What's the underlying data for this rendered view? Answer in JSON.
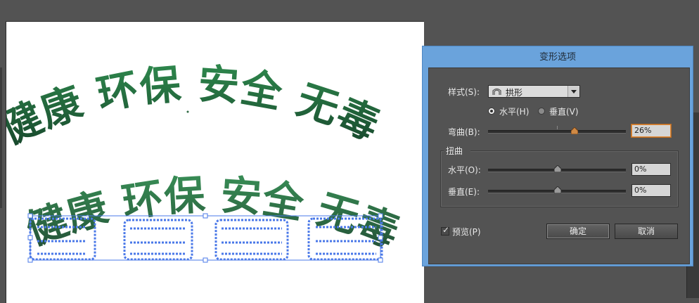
{
  "colors": {
    "workspace": "#535353",
    "dialog_title_bar": "#6aa3dc",
    "dialog_body": "#535353",
    "text_green_dark": "#1a4a2b",
    "text_green_light": "#2f8a4e",
    "selection_blue": "#4a78e8"
  },
  "artwork": {
    "upper_text": "健康 环保 安全 无毒",
    "lower_text": "健康 环保 安全 无毒"
  },
  "dialog": {
    "title": "变形选项",
    "style_label": "样式(S):",
    "style_icon": "arch-icon",
    "style_value": "拱形",
    "orientation": {
      "horizontal_label": "水平(H)",
      "vertical_label": "垂直(V)",
      "selected": "horizontal"
    },
    "bend": {
      "label": "弯曲(B):",
      "value": "26%",
      "level": 0.63
    },
    "distortion": {
      "group_label": "扭曲",
      "horizontal": {
        "label": "水平(O):",
        "value": "0%",
        "level": 0.5
      },
      "vertical": {
        "label": "垂直(E):",
        "value": "0%",
        "level": 0.5
      }
    },
    "preview": {
      "label": "预览(P)",
      "checked": true
    },
    "ok_label": "确定",
    "cancel_label": "取消"
  }
}
